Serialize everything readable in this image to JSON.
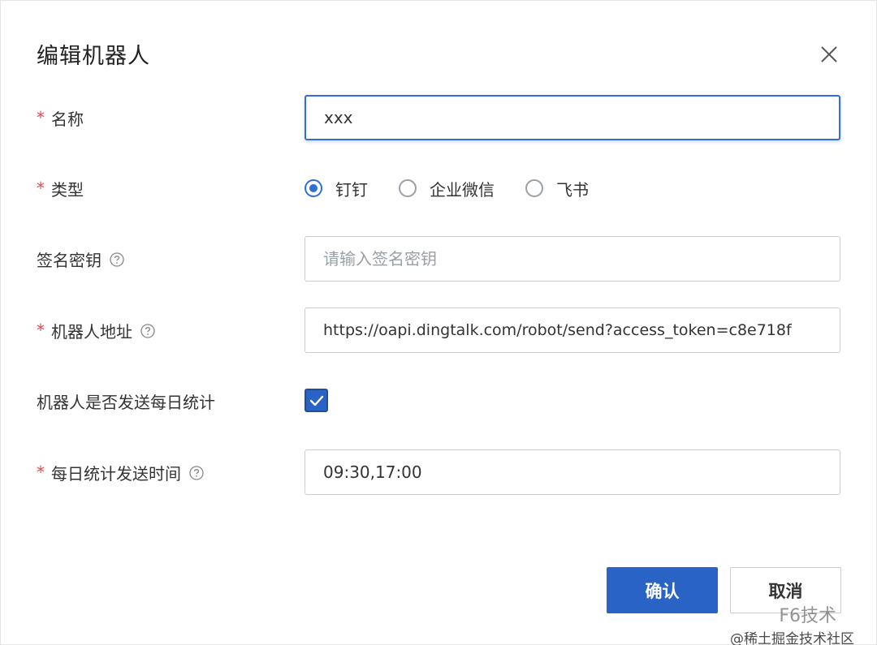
{
  "dialog": {
    "title": "编辑机器人"
  },
  "form": {
    "name": {
      "required_mark": "*",
      "label": "名称",
      "value": "xxx"
    },
    "type": {
      "required_mark": "*",
      "label": "类型",
      "options": [
        {
          "label": "钉钉",
          "checked": true
        },
        {
          "label": "企业微信",
          "checked": false
        },
        {
          "label": "飞书",
          "checked": false
        }
      ]
    },
    "secret": {
      "label": "签名密钥",
      "placeholder": "请输入签名密钥",
      "value": ""
    },
    "address": {
      "required_mark": "*",
      "label": "机器人地址",
      "value": "https://oapi.dingtalk.com/robot/send?access_token=c8e718f"
    },
    "daily_stats": {
      "label": "机器人是否发送每日统计",
      "checked": true
    },
    "send_time": {
      "required_mark": "*",
      "label": "每日统计发送时间",
      "value": "09:30,17:00"
    }
  },
  "buttons": {
    "confirm": "确认",
    "cancel": "取消"
  },
  "watermark": {
    "line1": "F6技术",
    "line2": "@稀土掘金技术社区"
  },
  "colors": {
    "accent": "#2a63c6",
    "required": "#e5484d",
    "border": "#c9ccd1"
  }
}
